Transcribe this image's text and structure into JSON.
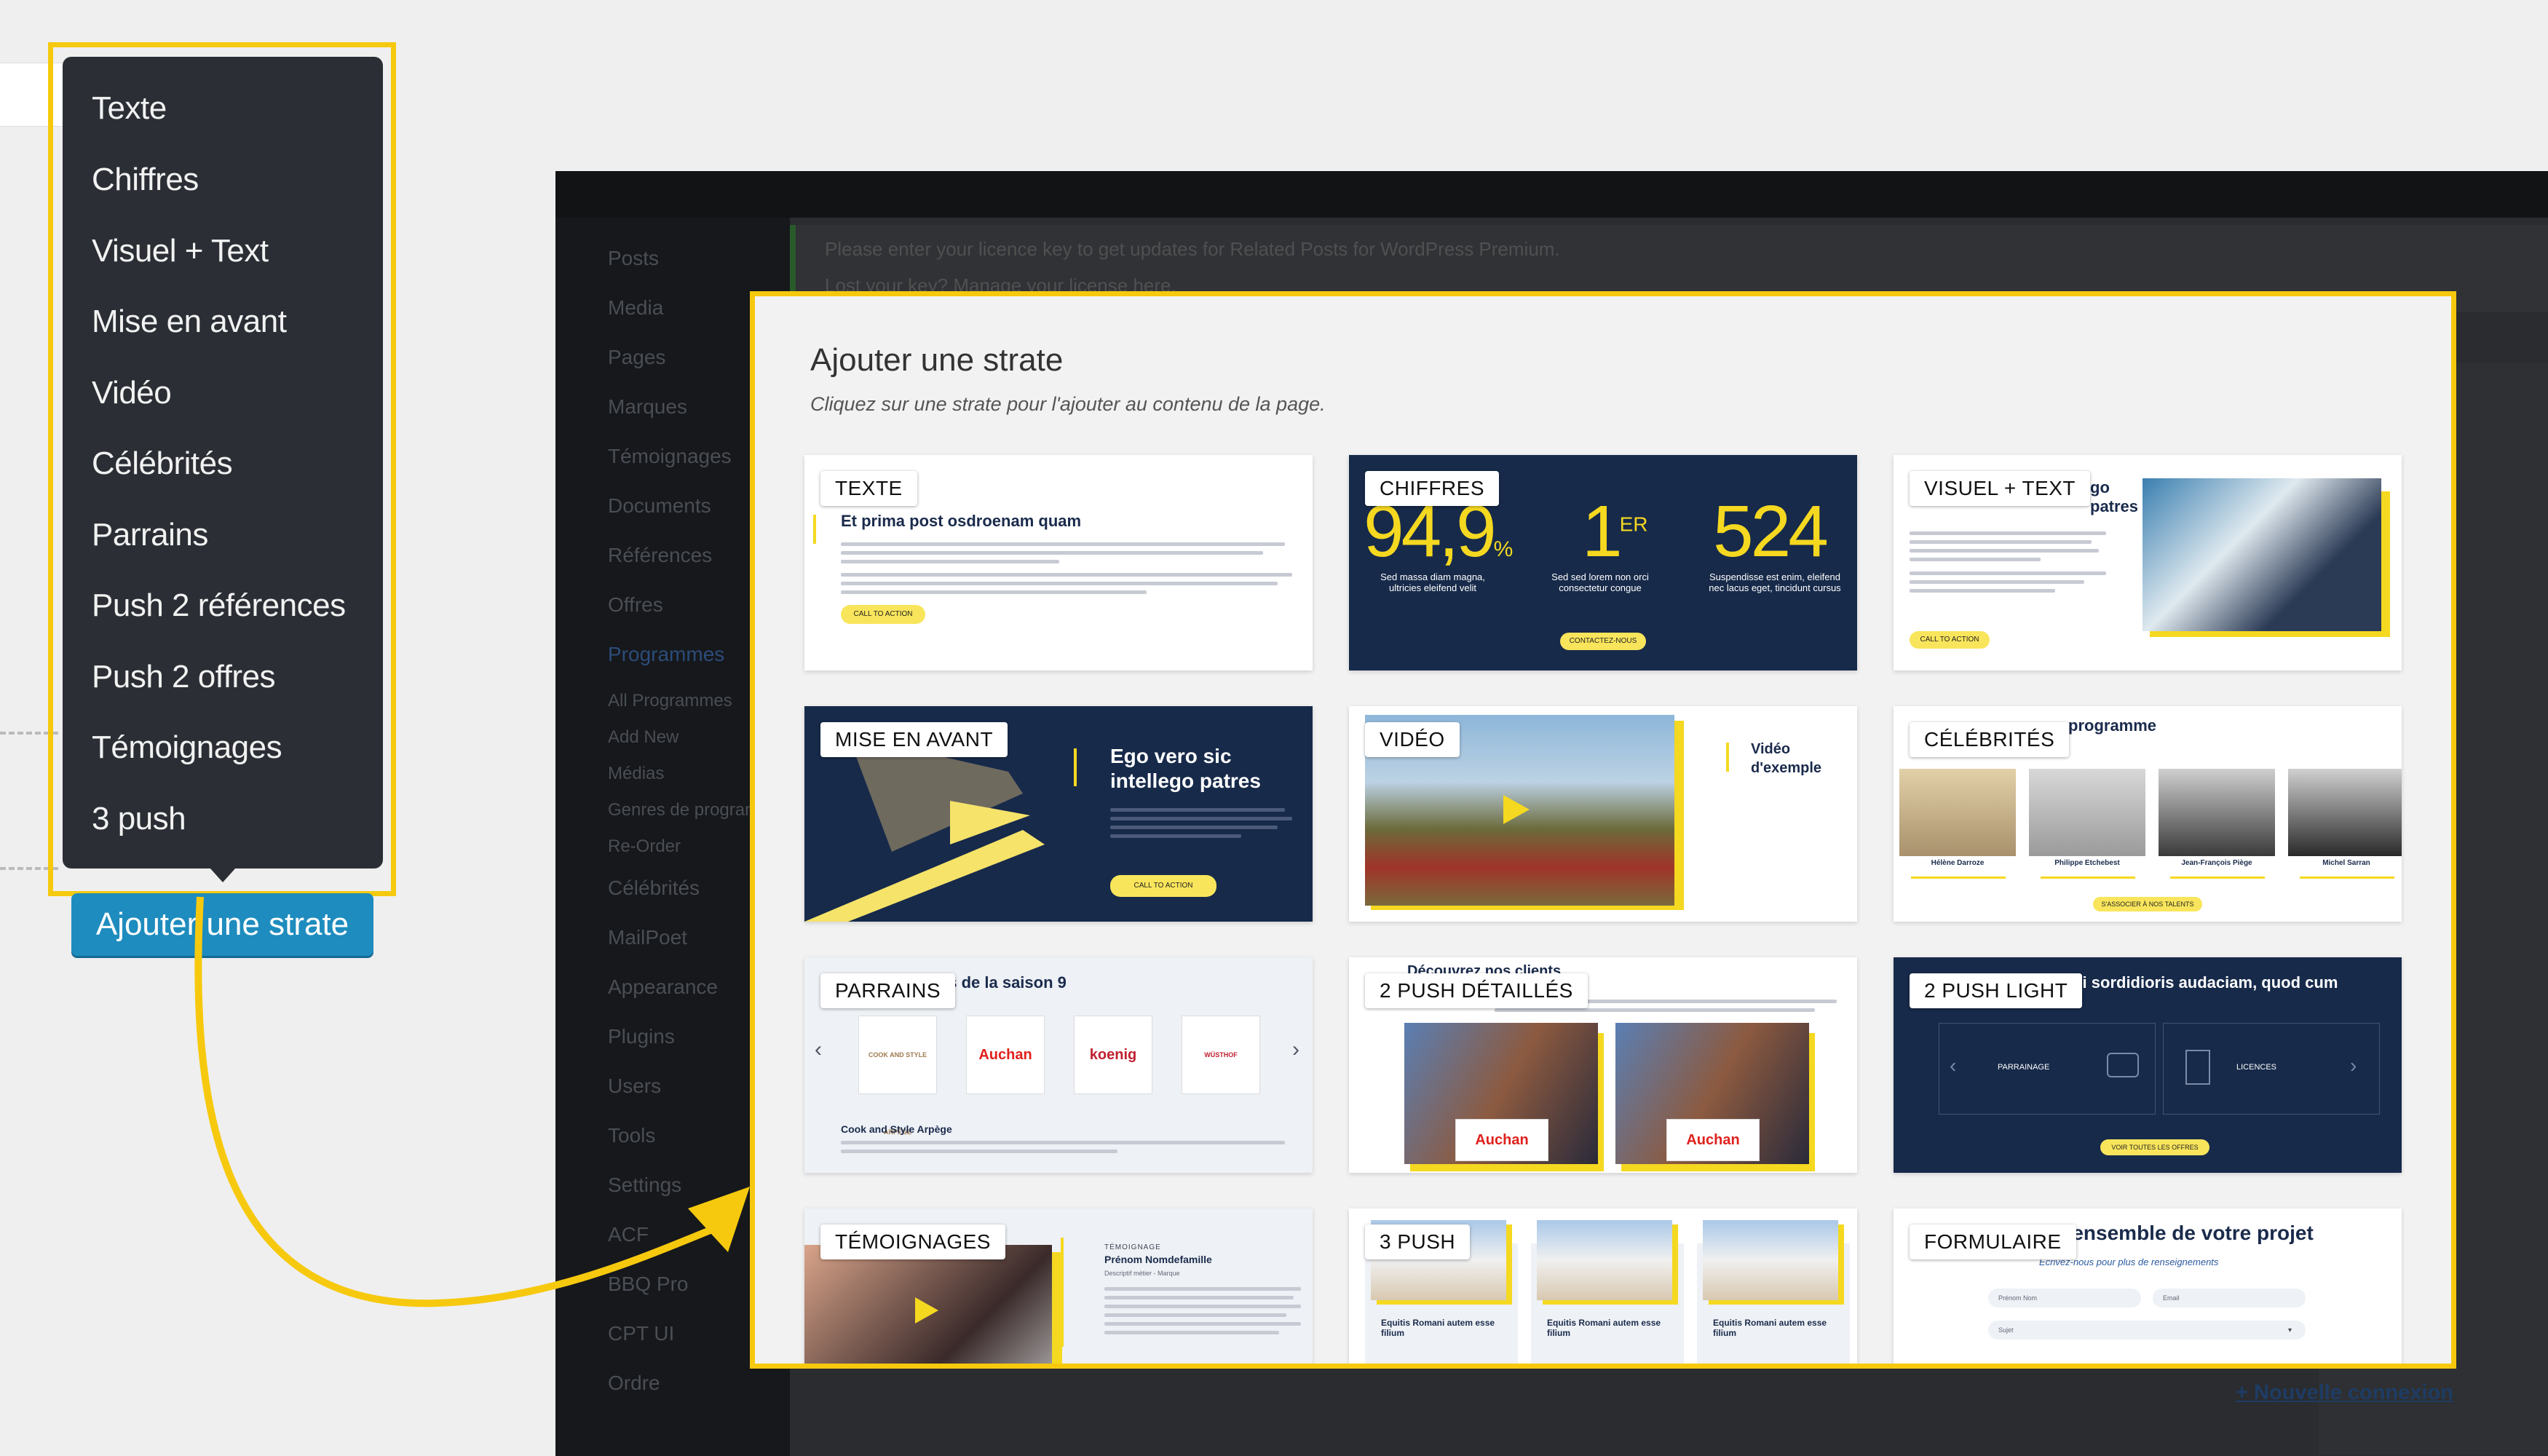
{
  "dropdown": {
    "items": [
      "Texte",
      "Chiffres",
      "Visuel + Text",
      "Mise en avant",
      "Vidéo",
      "Célébrités",
      "Parrains",
      "Push 2 références",
      "Push 2 offres",
      "Témoignages",
      "3 push"
    ]
  },
  "add_button_label": "Ajouter une strate",
  "wp": {
    "sidebar": [
      "Posts",
      "Media",
      "Pages",
      "Marques",
      "Témoignages",
      "Documents",
      "Références",
      "Offres",
      "Programmes",
      "All Programmes",
      "Add New",
      "Médias",
      "Genres de programme",
      "Re-Order",
      "Célébrités",
      "MailPoet",
      "Appearance",
      "Plugins",
      "Users",
      "Tools",
      "Settings",
      "ACF",
      "BBQ Pro",
      "CPT UI",
      "Ordre"
    ],
    "notice_line1": "Please enter your licence key to get updates for Related Posts for WordPress Premium.",
    "notice_line2": "Lost your key? Manage your license here.",
    "nouvelle_connexion": "+ Nouvelle connexion"
  },
  "modal": {
    "title": "Ajouter une strate",
    "subtitle": "Cliquez sur une strate pour l'ajouter au contenu de la page.",
    "cards": [
      {
        "label": "TEXTE",
        "heading": "Et prima post osdroenam quam",
        "cta": "CALL TO ACTION"
      },
      {
        "label": "CHIFFRES",
        "n1": "94,9",
        "n1_unit": "%",
        "n2": "1",
        "n2_sup": "ER",
        "n3": "524",
        "t1": "Sed massa diam magna, ultricies eleifend velit",
        "t2": "Sed sed lorem non orci consectetur congue",
        "t3": "Suspendisse est enim, eleifend nec lacus eget, tincidunt cursus",
        "cta": "CONTACTEZ-NOUS"
      },
      {
        "label": "VISUEL + TEXT",
        "heading_tail": "go patres",
        "cta": "CALL TO ACTION"
      },
      {
        "label": "MISE EN AVANT",
        "heading": "Ego vero sic intellego patres",
        "cta": "CALL TO ACTION"
      },
      {
        "label": "VIDÉO",
        "heading": "Vidéo d'exemple"
      },
      {
        "label": "CÉLÉBRITÉS",
        "heading_tail": "programme",
        "people": [
          "Hélène Darroze",
          "Philippe Etchebest",
          "Jean-François Piège",
          "Michel Sarran"
        ],
        "cta": "S'ASSOCIER À NOS TALENTS"
      },
      {
        "label": "PARRAINS",
        "heading_tail": "es de la saison 9",
        "logos": [
          "COOK AND STYLE ARPÈGE",
          "Auchan",
          "koenig",
          "WÜSTHOF"
        ],
        "caption": "Cook and Style Arpège"
      },
      {
        "label": "2 PUSH DÉTAILLÉS",
        "heading_tail": "Découvrez nos clients",
        "brand": "Auchan"
      },
      {
        "label": "2 PUSH LIGHT",
        "heading_tail": "lgi sordidioris audaciam, quod cum",
        "box1": "PARRAINAGE",
        "box2": "LICENCES",
        "cta": "VOIR TOUTES LES OFFRES"
      },
      {
        "label": "TÉMOIGNAGES",
        "kicker": "TÉMOIGNAGE",
        "name": "Prénom Nomdefamille",
        "role": "Descriptif métier - Marque"
      },
      {
        "label": "3 PUSH",
        "item": "Equitis Romani autem esse filium"
      },
      {
        "label": "FORMULAIRE",
        "heading_tail": "s ensemble de votre projet",
        "sub": "Écrivez-nous pour plus de renseignements",
        "f1": "Prénom Nom",
        "f2": "Email",
        "f3": "Sujet"
      }
    ]
  },
  "colors": {
    "accent": "#f6c90e",
    "wp_button": "#1e8cbe",
    "navy": "#172a4a",
    "menu_bg": "#2b2f35"
  }
}
